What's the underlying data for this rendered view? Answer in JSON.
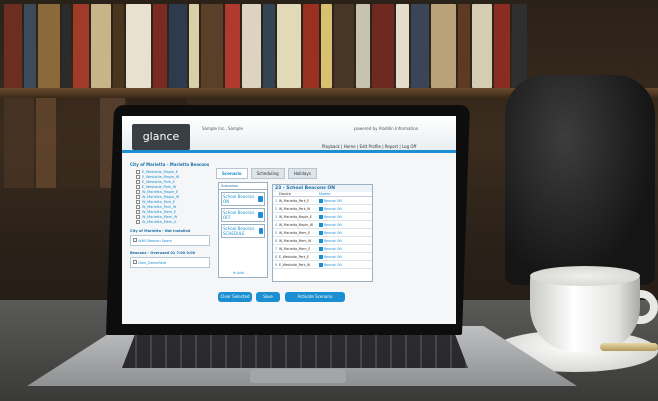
{
  "app": {
    "logo": "glance",
    "header_left": "Sample Inc., Sample",
    "powered": "powered by Aladdin Information",
    "nav": [
      "Playback",
      "Home",
      "Edit Profile",
      "Report",
      "Log Off"
    ]
  },
  "sidebar": {
    "title": "City of Marietta - Marietta Beacons",
    "items": [
      "E_Westside_Maple_E",
      "E_Westside_Maple_W",
      "E_Westside_Park_E",
      "E_Westside_Park_W",
      "W_Marietta_Maple_E",
      "W_Marietta_Maple_W",
      "W_Marietta_Park_E",
      "W_Marietta_Park_W",
      "W_Marietta_Mem_E",
      "W_Marietta_Mem_W",
      "W_Marietta_Mem_S"
    ],
    "section": "City of Marietta - Not Installed",
    "box1": "WHS Beacon Spare",
    "section2": "Beacons - Overused 01 7:00 0:00",
    "box2": "Dem_Demofield"
  },
  "tabs": [
    "Scenario",
    "Scheduling",
    "Holidays"
  ],
  "scenarios": {
    "header": "Scenarios",
    "items": [
      "School Beacons ON",
      "School Beacons OFF",
      "School Beacons SCHEDULE"
    ],
    "add": "Add"
  },
  "grid": {
    "title": "23 - School Beacons ON",
    "col1": "Device",
    "col2": "Modes",
    "rows": [
      {
        "n": "1",
        "device": "W_Marietta_Park_E",
        "mode": "Beacon ON"
      },
      {
        "n": "2",
        "device": "W_Marietta_Park_W",
        "mode": "Beacon ON"
      },
      {
        "n": "3",
        "device": "W_Marietta_Maple_E",
        "mode": "Beacon ON"
      },
      {
        "n": "4",
        "device": "W_Marietta_Maple_W",
        "mode": "Beacon ON"
      },
      {
        "n": "5",
        "device": "W_Marietta_Mem_E",
        "mode": "Beacon ON"
      },
      {
        "n": "6",
        "device": "W_Marietta_Mem_W",
        "mode": "Beacon ON"
      },
      {
        "n": "7",
        "device": "W_Marietta_Mem_S",
        "mode": "Beacon ON"
      },
      {
        "n": "8",
        "device": "E_Westside_Park_E",
        "mode": "Beacon ON"
      },
      {
        "n": "9",
        "device": "E_Westside_Park_W",
        "mode": "Beacon ON"
      }
    ]
  },
  "buttons": {
    "clear": "Clear Selected",
    "save": "Save",
    "activate": "Activate Scenario"
  },
  "colors": {
    "accent": "#1b8fd2"
  }
}
